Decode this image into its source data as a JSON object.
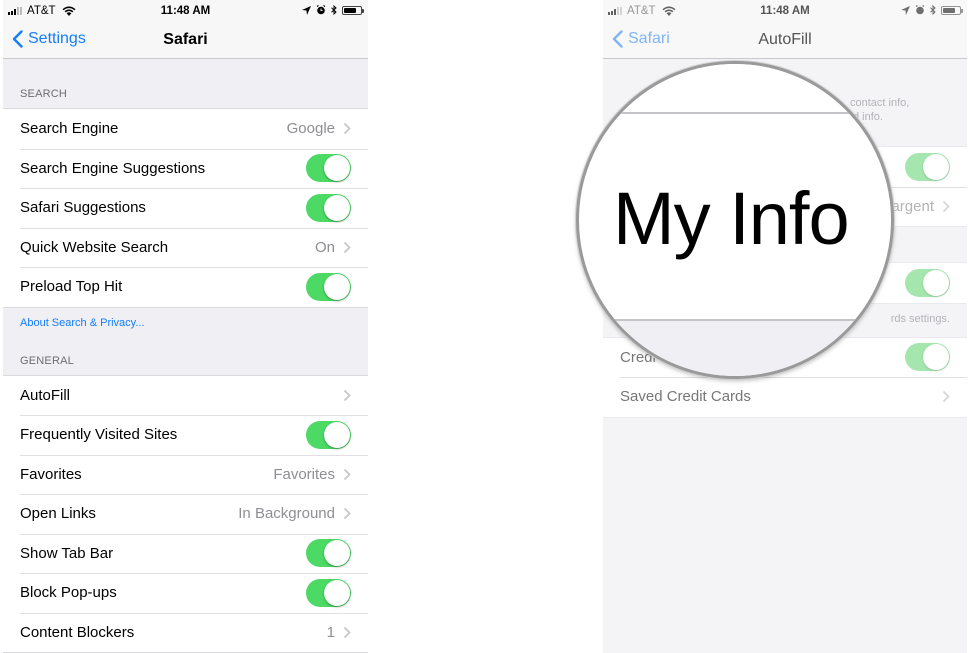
{
  "left_screen": {
    "status_bar": {
      "carrier": "AT&T",
      "time": "11:48 AM",
      "icons": [
        "signal-icon",
        "wifi-icon",
        "location-icon",
        "alarm-icon",
        "bluetooth-icon",
        "battery-icon"
      ]
    },
    "nav": {
      "back_label": "Settings",
      "title": "Safari"
    },
    "sections": [
      {
        "header": "SEARCH",
        "rows": [
          {
            "label": "Search Engine",
            "detail": "Google",
            "type": "disclosure"
          },
          {
            "label": "Search Engine Suggestions",
            "type": "toggle",
            "on": true
          },
          {
            "label": "Safari Suggestions",
            "type": "toggle",
            "on": true
          },
          {
            "label": "Quick Website Search",
            "detail": "On",
            "type": "disclosure"
          },
          {
            "label": "Preload Top Hit",
            "type": "toggle",
            "on": true
          }
        ],
        "footer_link": "About Search & Privacy..."
      },
      {
        "header": "GENERAL",
        "rows": [
          {
            "label": "AutoFill",
            "detail": "",
            "type": "disclosure"
          },
          {
            "label": "Frequently Visited Sites",
            "type": "toggle",
            "on": true
          },
          {
            "label": "Favorites",
            "detail": "Favorites",
            "type": "disclosure"
          },
          {
            "label": "Open Links",
            "detail": "In Background",
            "type": "disclosure"
          },
          {
            "label": "Show Tab Bar",
            "type": "toggle",
            "on": true
          },
          {
            "label": "Block Pop-ups",
            "type": "toggle",
            "on": true
          },
          {
            "label": "Content Blockers",
            "detail": "1",
            "type": "disclosure"
          }
        ]
      }
    ]
  },
  "right_screen": {
    "status_bar": {
      "carrier": "AT&T",
      "time": "11:48 AM"
    },
    "nav": {
      "back_label": "Safari",
      "title": "AutoFill"
    },
    "description_partial": [
      "contact info,",
      "d info."
    ],
    "rows_group1": [
      {
        "label": "",
        "type": "toggle",
        "on": true
      },
      {
        "label": "",
        "detail": "argent",
        "type": "disclosure"
      }
    ],
    "rows_group2": [
      {
        "label": "",
        "type": "toggle",
        "on": true
      }
    ],
    "note_partial": "rds settings.",
    "rows_group3": [
      {
        "label": "Credi",
        "type": "toggle",
        "on": true
      },
      {
        "label": "Saved Credit Cards",
        "detail": "",
        "type": "disclosure"
      }
    ],
    "magnifier": {
      "label": "My Info"
    }
  },
  "colors": {
    "accent_blue": "#147efb",
    "toggle_green": "#4cd964",
    "background_gray": "#efeff4",
    "secondary_text": "#8e8e93"
  }
}
